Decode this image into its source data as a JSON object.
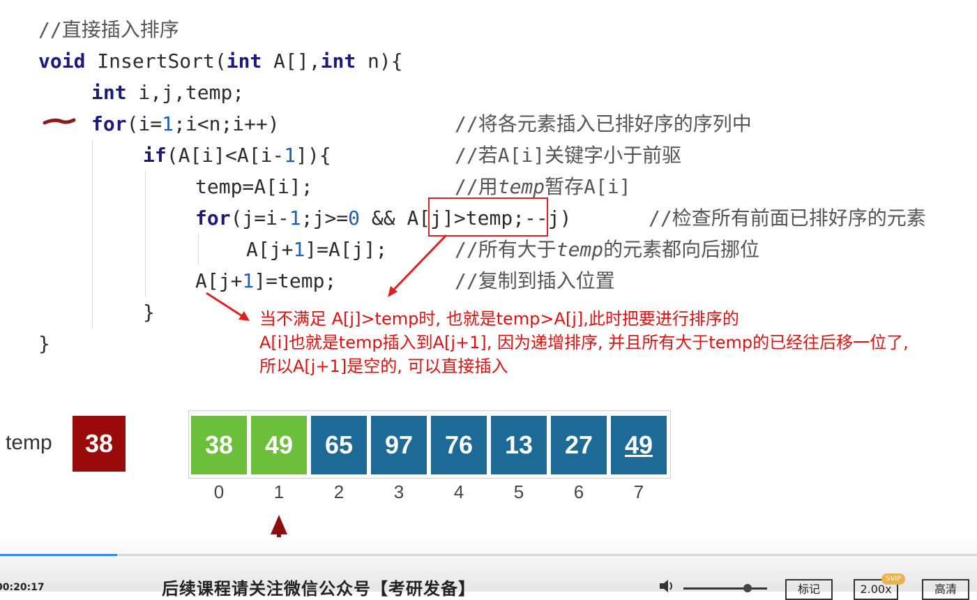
{
  "code": {
    "comment_title": "//直接插入排序",
    "l1": {
      "kw1": "void",
      "fn": " InsertSort(",
      "kw2": "int",
      "p1": " A[],",
      "kw3": "int",
      "p2": " n){"
    },
    "l2": {
      "kw": "int",
      "rest": " i,j,temp;"
    },
    "l3": {
      "kw": "for",
      "a": "(i=",
      "n1": "1",
      "b": ";i<n;i++)",
      "comment": "//将各元素插入已排好序的序列中"
    },
    "l4": {
      "kw": "if",
      "a": "(A[i]<A[i-",
      "n1": "1",
      "b": "]){",
      "comment": "//若A[i]关键字小于前驱"
    },
    "l5": {
      "code": "temp=A[i];",
      "comment_a": "//用",
      "comment_i": "temp",
      "comment_b": "暂存A[i]"
    },
    "l6": {
      "kw": "for",
      "a": "(j=i-",
      "n1": "1",
      "b": ";j>=",
      "n2": "0",
      "c": " && ",
      "hl": "A[j]>temp",
      "d": ";--j)",
      "comment": "//检查所有前面已排好序的元素"
    },
    "l7": {
      "a": "A[j+",
      "n1": "1",
      "b": "]=A[j];",
      "comment_a": "//所有大于",
      "comment_i": "temp",
      "comment_b": "的元素都向后挪位"
    },
    "l8": {
      "a": "A[j+",
      "n1": "1",
      "b": "]=temp;",
      "comment": "//复制到插入位置"
    },
    "l9": "}",
    "l10": "}"
  },
  "note": {
    "line1": "当不满足 A[j]>temp时, 也就是temp>A[j],此时把要进行排序的",
    "line2": "A[i]也就是temp插入到A[j+1], 因为递增排序, 并且所有大于temp的已经往后移一位了,",
    "line3": "所以A[j+1]是空的, 可以直接插入"
  },
  "array": {
    "temp_label": "temp",
    "temp_value": "38",
    "values": [
      "38",
      "49",
      "65",
      "97",
      "76",
      "13",
      "27",
      "49"
    ],
    "indices": [
      "0",
      "1",
      "2",
      "3",
      "4",
      "5",
      "6",
      "7"
    ],
    "colors": {
      "sorted": "#6cbf3a",
      "unsorted": "#1c6a95",
      "temp": "#9b0a0a"
    }
  },
  "player": {
    "time": "00:20:17",
    "subtitle": "后续课程请关注微信公众号【考研发备】",
    "mark_label": "标记",
    "speed_label": "2.00x",
    "svip_badge": "SVIP",
    "quality_label": "高清",
    "progress": 0.12
  }
}
